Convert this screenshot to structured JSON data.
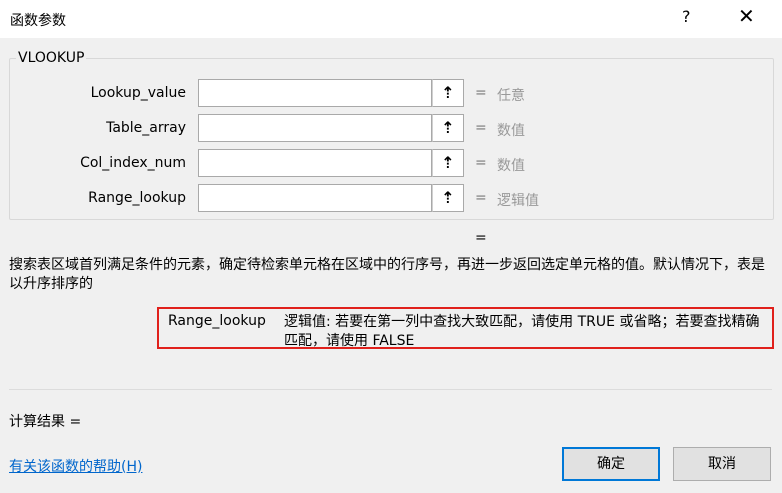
{
  "window": {
    "title": "函数参数",
    "help_glyph": "?",
    "close_glyph": "✕"
  },
  "function_name": "VLOOKUP",
  "args": [
    {
      "label": "Lookup_value",
      "value": "",
      "eq": "=",
      "hint": "任意"
    },
    {
      "label": "Table_array",
      "value": "",
      "eq": "=",
      "hint": "数值"
    },
    {
      "label": "Col_index_num",
      "value": "",
      "eq": "=",
      "hint": "数值"
    },
    {
      "label": "Range_lookup",
      "value": "",
      "eq": "=",
      "hint": "逻辑值"
    }
  ],
  "ref_glyph": "⇡",
  "result_eq": "=",
  "description": "搜索表区域首列满足条件的元素，确定待检索单元格在区域中的行序号，再进一步返回选定单元格的值。默认情况下，表是以升序排序的",
  "param_help": {
    "name": "Range_lookup",
    "text": "逻辑值: 若要在第一列中查找大致匹配，请使用 TRUE 或省略；若要查找精确匹配，请使用 FALSE"
  },
  "calc_result": "计算结果 =",
  "help_link": "有关该函数的帮助(H)",
  "buttons": {
    "ok": "确定",
    "cancel": "取消"
  }
}
